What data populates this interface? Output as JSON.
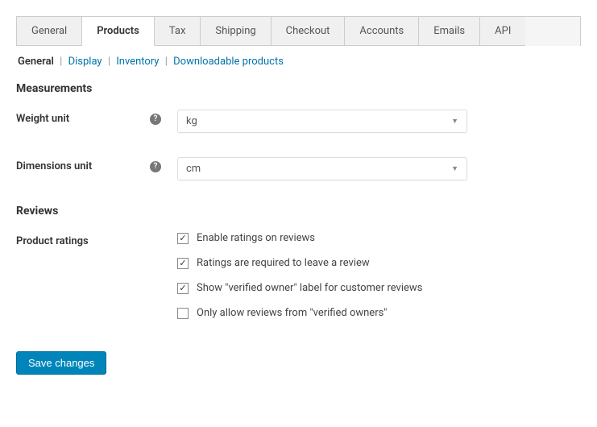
{
  "tabs": {
    "general": "General",
    "products": "Products",
    "tax": "Tax",
    "shipping": "Shipping",
    "checkout": "Checkout",
    "accounts": "Accounts",
    "emails": "Emails",
    "api": "API"
  },
  "subtabs": {
    "general": "General",
    "display": "Display",
    "inventory": "Inventory",
    "downloadable": "Downloadable products"
  },
  "sections": {
    "measurements": "Measurements",
    "reviews": "Reviews"
  },
  "fields": {
    "weight_unit": {
      "label": "Weight unit",
      "value": "kg"
    },
    "dimensions_unit": {
      "label": "Dimensions unit",
      "value": "cm"
    },
    "product_ratings": {
      "label": "Product ratings"
    }
  },
  "checkboxes": {
    "enable_ratings": {
      "label": "Enable ratings on reviews",
      "checked": true
    },
    "ratings_required": {
      "label": "Ratings are required to leave a review",
      "checked": true
    },
    "verified_label": {
      "label": "Show \"verified owner\" label for customer reviews",
      "checked": true
    },
    "verified_only": {
      "label": "Only allow reviews from \"verified owners\"",
      "checked": false
    }
  },
  "buttons": {
    "save": "Save changes"
  },
  "icons": {
    "help": "?"
  }
}
